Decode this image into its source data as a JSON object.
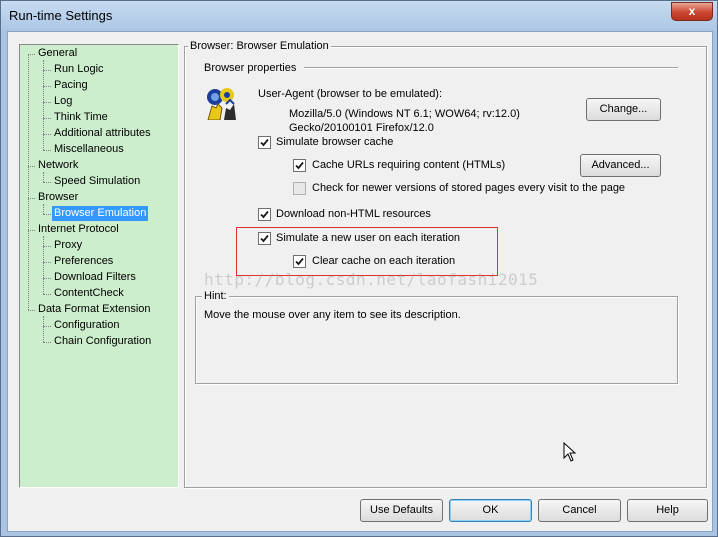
{
  "window": {
    "title": "Run-time Settings",
    "close_label": "x"
  },
  "tree": {
    "items": [
      {
        "label": "General",
        "level": 0
      },
      {
        "label": "Run Logic",
        "level": 1
      },
      {
        "label": "Pacing",
        "level": 1
      },
      {
        "label": "Log",
        "level": 1
      },
      {
        "label": "Think Time",
        "level": 1
      },
      {
        "label": "Additional attributes",
        "level": 1
      },
      {
        "label": "Miscellaneous",
        "level": 1
      },
      {
        "label": "Network",
        "level": 0
      },
      {
        "label": "Speed Simulation",
        "level": 1
      },
      {
        "label": "Browser",
        "level": 0
      },
      {
        "label": "Browser Emulation",
        "level": 1,
        "selected": true
      },
      {
        "label": "Internet Protocol",
        "level": 0
      },
      {
        "label": "Proxy",
        "level": 1
      },
      {
        "label": "Preferences",
        "level": 1
      },
      {
        "label": "Download Filters",
        "level": 1
      },
      {
        "label": "ContentCheck",
        "level": 1
      },
      {
        "label": "Data Format Extension",
        "level": 0
      },
      {
        "label": "Configuration",
        "level": 1
      },
      {
        "label": "Chain Configuration",
        "level": 1
      }
    ]
  },
  "panel": {
    "group_title": "Browser: Browser Emulation",
    "section_title": "Browser properties",
    "user_agent_label": "User-Agent (browser to be emulated):",
    "user_agent_line1": "Mozilla/5.0 (Windows NT 6.1; WOW64; rv:12.0)",
    "user_agent_line2": "Gecko/20100101 Firefox/12.0",
    "change_button": "Change...",
    "advanced_button": "Advanced...",
    "checkboxes": {
      "simulate_cache": {
        "label": "Simulate browser cache",
        "checked": true
      },
      "cache_urls": {
        "label": "Cache URLs requiring content (HTMLs)",
        "checked": true
      },
      "check_newer": {
        "label": "Check for newer versions of stored pages every visit to the page",
        "checked": false
      },
      "download_non_html": {
        "label": "Download non-HTML resources",
        "checked": true
      },
      "new_user": {
        "label": "Simulate a new user on each iteration",
        "checked": true
      },
      "clear_cache": {
        "label": "Clear cache on each iteration",
        "checked": true
      }
    },
    "hint_title": "Hint:",
    "hint_text": "Move the mouse over any item to see its description."
  },
  "watermark": "http://blog.csdn.net/laofashi2015",
  "footer": {
    "use_defaults": "Use Defaults",
    "ok": "OK",
    "cancel": "Cancel",
    "help": "Help"
  },
  "colors": {
    "tree_background": "#cdeecd",
    "selection": "#3399ff",
    "highlight_box": "#e03030"
  }
}
